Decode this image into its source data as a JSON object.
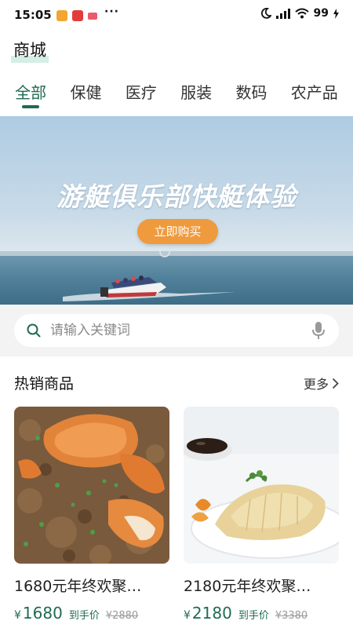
{
  "status_bar": {
    "time": "15:05",
    "more": "···",
    "battery": "99"
  },
  "header": {
    "title": "商城"
  },
  "tabs": [
    {
      "label": "全部",
      "active": true
    },
    {
      "label": "保健",
      "active": false
    },
    {
      "label": "医疗",
      "active": false
    },
    {
      "label": "服装",
      "active": false
    },
    {
      "label": "数码",
      "active": false
    },
    {
      "label": "农产品",
      "active": false
    }
  ],
  "banner": {
    "title": "游艇俱乐部快艇体验",
    "button_label": "立即购买"
  },
  "search": {
    "placeholder": "请输入关键词",
    "value": ""
  },
  "hot_section": {
    "title": "热销商品",
    "more_label": "更多"
  },
  "products": [
    {
      "name": "1680元年终欢聚…",
      "currency": "¥",
      "price": "1680",
      "price_note": "到手价",
      "original_price": "¥2880"
    },
    {
      "name": "2180元年终欢聚…",
      "currency": "¥",
      "price": "2180",
      "price_note": "到手价",
      "original_price": "¥3380"
    }
  ],
  "colors": {
    "accent": "#1f6b52",
    "banner_button": "#ef9a3d",
    "search_bg": "#f3f3f3"
  },
  "icons": [
    "moon-icon",
    "signal-icon",
    "wifi-icon",
    "battery-icon",
    "search-icon",
    "mic-icon",
    "chevron-right-icon"
  ]
}
